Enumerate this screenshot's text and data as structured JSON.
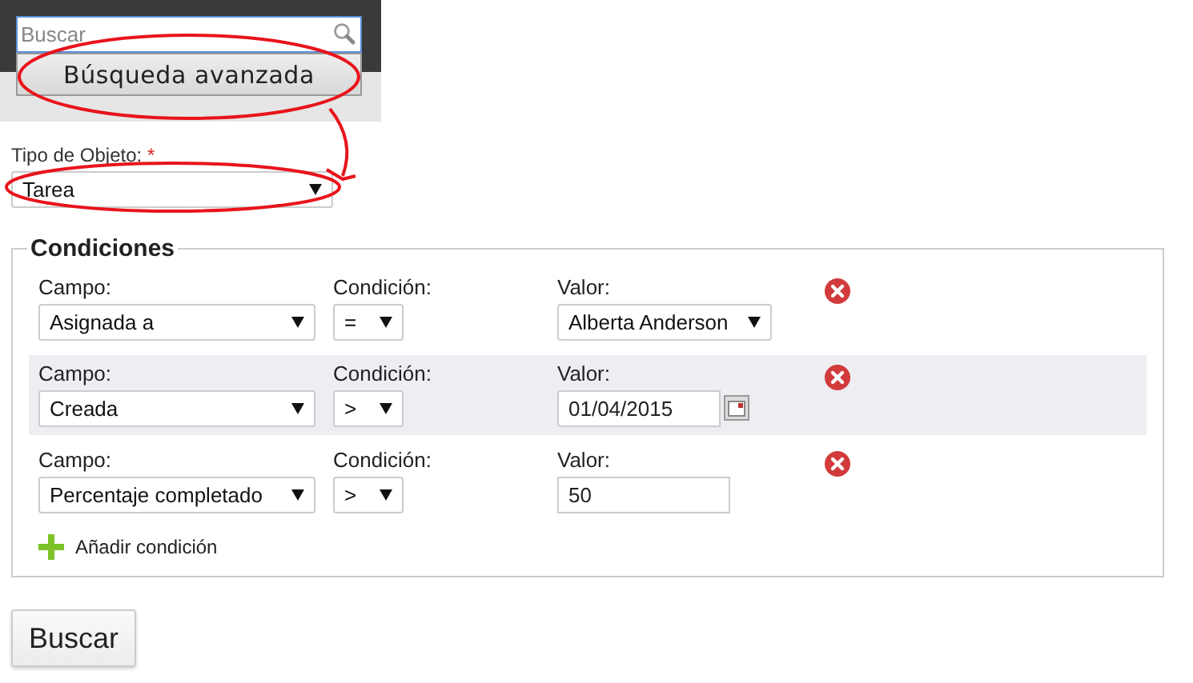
{
  "search": {
    "placeholder": "Buscar"
  },
  "advanced_button": "Búsqueda avanzada",
  "object_type": {
    "label": "Tipo de Objeto:",
    "required_mark": "*",
    "value": "Tarea"
  },
  "conditions": {
    "title": "Condiciones",
    "rows": [
      {
        "field_label": "Campo:",
        "field": "Asignada a",
        "condition_label": "Condición:",
        "condition": "=",
        "value_label": "Valor:",
        "kind": "select",
        "value": "Alberta Anderson",
        "highlighted": false
      },
      {
        "field_label": "Campo:",
        "field": "Creada",
        "condition_label": "Condición:",
        "condition": ">",
        "value_label": "Valor:",
        "kind": "date",
        "value": "01/04/2015",
        "highlighted": true
      },
      {
        "field_label": "Campo:",
        "field": "Percentaje completado",
        "condition_label": "Condición:",
        "condition": ">",
        "value_label": "Valor:",
        "kind": "text",
        "value": "50",
        "highlighted": false
      }
    ],
    "add_label": "Añadir condición"
  },
  "search_button": {
    "label": "Buscar"
  },
  "annotations": [
    {
      "kind": "ellipse"
    },
    {
      "kind": "ellipse"
    },
    {
      "kind": "arrow"
    }
  ]
}
